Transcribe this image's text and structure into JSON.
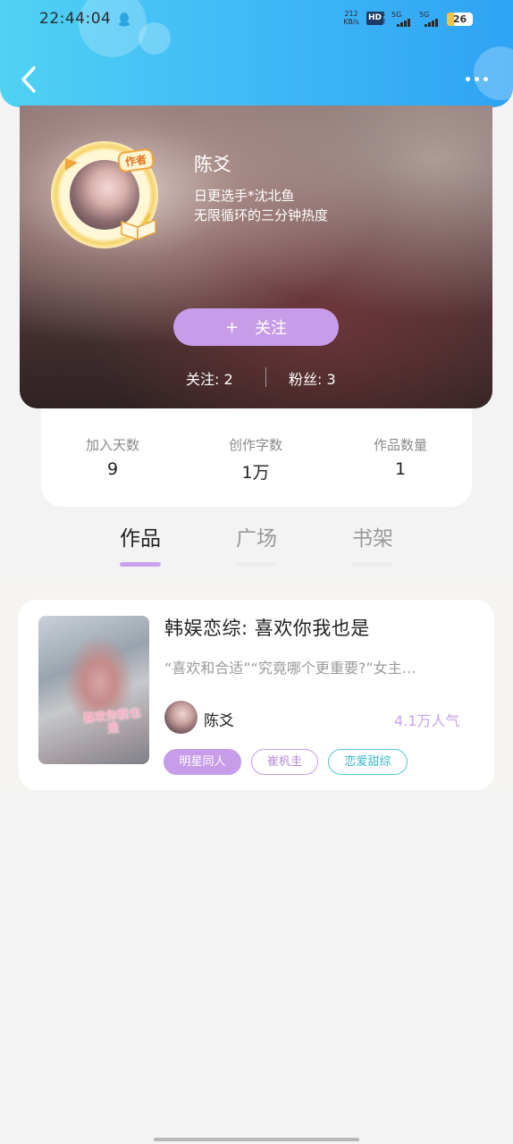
{
  "status_bar": {
    "time": "22:44:04",
    "net_speed_value": "212",
    "net_speed_unit": "KB/s",
    "hd_label": "HD",
    "hd_sub_1": "1",
    "hd_sub_2": "2",
    "signal1_label": "5G",
    "signal2_label": "5G",
    "battery": "26",
    "battery_level": 0.26
  },
  "header": {
    "back_icon": "chevron-left-icon",
    "more_icon": "more-dots-icon"
  },
  "profile": {
    "author_badge": "作者",
    "name": "陈爻",
    "bio_line1": "日更选手*沈北鱼",
    "bio_line2": "无限循环的三分钟热度",
    "follow_icon": "+",
    "follow_label": "关注",
    "following": "关注: 2",
    "fans": "粉丝: 3"
  },
  "stats": [
    {
      "label": "加入天数",
      "value": "9"
    },
    {
      "label": "创作字数",
      "value": "1万"
    },
    {
      "label": "作品数量",
      "value": "1"
    }
  ],
  "tabs": [
    {
      "label": "作品",
      "active": true
    },
    {
      "label": "广场",
      "active": false
    },
    {
      "label": "书架",
      "active": false
    }
  ],
  "works": [
    {
      "cover_text": "喜欢你我也是",
      "title": "韩娱恋综: 喜欢你我也是",
      "description": "“喜欢和合适”“究竟哪个更重要?”女主…",
      "author": "陈爻",
      "popularity": "4.1万人气",
      "tags": [
        "明星同人",
        "崔杋圭",
        "恋爱甜综"
      ]
    }
  ],
  "colors": {
    "header_gradient_start": "#4fd2f4",
    "header_gradient_end": "#2fa3f4",
    "accent_purple": "#c79ce8",
    "tag_teal": "#56c7d9"
  }
}
